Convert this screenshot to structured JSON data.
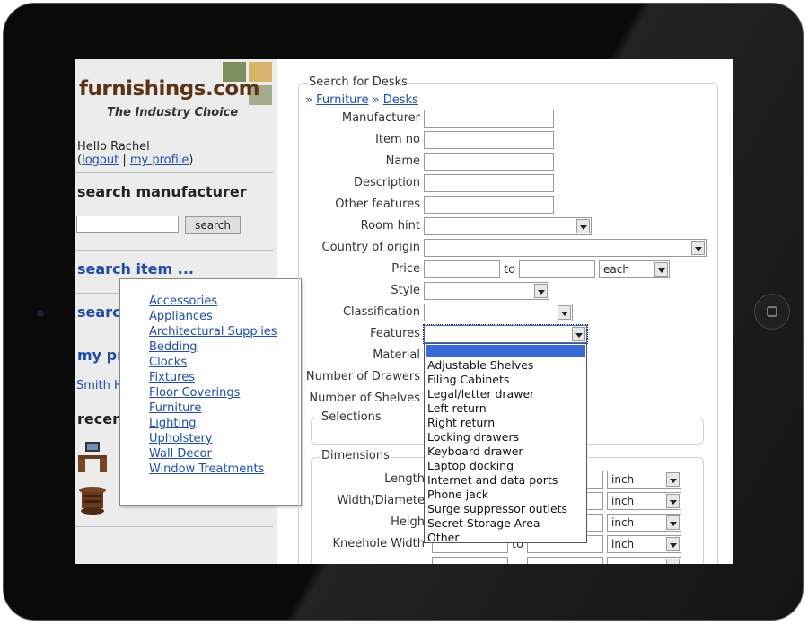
{
  "logo": {
    "text": "furnishings.com",
    "tagline": "The Industry Choice",
    "colors": [
      "#7d8f5e",
      "#d8b36a",
      "#a4ab8c",
      "#8a936f"
    ]
  },
  "user": {
    "greeting": "Hello Rachel",
    "open_paren": "(",
    "logout": "logout",
    "separator": " | ",
    "profile": "my profile",
    "close_paren": ")"
  },
  "sidebar": {
    "search_manufacturer": "search manufacturer",
    "search_button": "search",
    "search_item": "search item ...",
    "search2": "searc",
    "my_profile": "my pr",
    "partial_link": "Smith H",
    "recent": "recen"
  },
  "category_menu": [
    "Accessories",
    "Appliances",
    "Architectural Supplies",
    "Bedding",
    "Clocks",
    "Fixtures",
    "Floor Coverings",
    "Furniture",
    "Lighting",
    "Upholstery",
    "Wall Decor",
    "Window Treatments"
  ],
  "form": {
    "legend": "Search for Desks",
    "breadcrumb": {
      "sep": "»",
      "items": [
        "Furniture",
        "Desks"
      ]
    },
    "labels": {
      "manufacturer": "Manufacturer",
      "item_no": "Item no",
      "name": "Name",
      "description": "Description",
      "other_features": "Other features",
      "room_hint": "Room hint",
      "country": "Country of origin",
      "price": "Price",
      "price_to": "to",
      "style": "Style",
      "classification": "Classification",
      "features": "Features",
      "material": "Material",
      "drawers": "Number of Drawers",
      "shelves": "Number of Shelves"
    },
    "price_unit": "each",
    "selections_legend": "Selections",
    "dimensions": {
      "legend": "Dimensions",
      "rows": [
        {
          "label": "Length",
          "unit": "inch"
        },
        {
          "label": "Width/Diamete",
          "unit": "inch"
        },
        {
          "label": "Heigh",
          "unit": "inch"
        },
        {
          "label": "Kneehole Width",
          "unit": "inch"
        }
      ],
      "to": "to"
    }
  },
  "features_options": [
    "Adjustable Shelves",
    "Filing Cabinets",
    "Legal/letter drawer",
    "Left return",
    "Right return",
    "Locking drawers",
    "Keyboard drawer",
    "Laptop docking",
    "Internet and data ports",
    "Phone jack",
    "Surge suppressor outlets",
    "Secret Storage Area",
    "Other"
  ]
}
